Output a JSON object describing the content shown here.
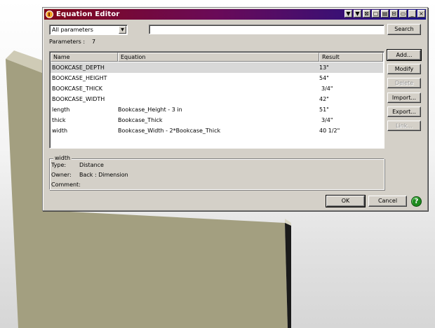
{
  "window": {
    "title": "Equation Editor",
    "titlebar_buttons": [
      "▼",
      "▼",
      "⊠",
      "▢",
      "▤",
      "⊟",
      "▭",
      "_",
      "×"
    ]
  },
  "filter": {
    "selected": "All parameters"
  },
  "search": {
    "value": "",
    "button_label": "Search"
  },
  "parameters": {
    "label": "Parameters :",
    "count": "7"
  },
  "table": {
    "columns": [
      "Name",
      "Equation",
      "Result"
    ],
    "rows": [
      {
        "name": "BOOKCASE_DEPTH",
        "equation": "",
        "result": "13\""
      },
      {
        "name": "BOOKCASE_HEIGHT",
        "equation": "",
        "result": "54\""
      },
      {
        "name": "BOOKCASE_THICK",
        "equation": "",
        "result": "3/4\""
      },
      {
        "name": "BOOKCASE_WIDTH",
        "equation": "",
        "result": "42\""
      },
      {
        "name": "length",
        "equation": "Bookcase_Height - 3 in",
        "result": "51\""
      },
      {
        "name": "thick",
        "equation": "Bookcase_Thick",
        "result": "3/4\""
      },
      {
        "name": "width",
        "equation": "Bookcase_Width - 2*Bookcase_Thick",
        "result": "40 1/2\""
      }
    ]
  },
  "side_buttons": {
    "add": "Add...",
    "modify": "Modify",
    "delete": "Delete",
    "import": "Import...",
    "export": "Export...",
    "link": "Link..."
  },
  "details": {
    "group_title": "width",
    "type_label": "Type:",
    "type_value": "Distance",
    "owner_label": "Owner:",
    "owner_value": "Back : Dimension",
    "comment_label": "Comment:",
    "comment_value": ""
  },
  "footer": {
    "ok": "OK",
    "cancel": "Cancel",
    "help_icon": "?"
  },
  "colors": {
    "dialog_bg": "#d4d0c8",
    "titlebar_start": "#80081a",
    "titlebar_end": "#1a1488",
    "board": "#a39f80",
    "help": "#1e8a1e"
  }
}
